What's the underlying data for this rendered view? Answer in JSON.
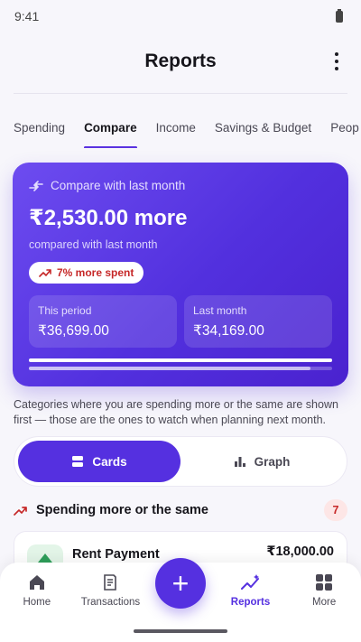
{
  "status": {
    "time": "9:41"
  },
  "header": {
    "title": "Reports"
  },
  "tabs": [
    "Spending",
    "Compare",
    "Income",
    "Savings & Budget",
    "Peop"
  ],
  "hero": {
    "heading": "Compare with last month",
    "amount": "₹2,530.00 more",
    "subtitle": "compared with last month",
    "pill": "7% more spent",
    "this_period_label": "This period",
    "this_period_value": "₹36,699.00",
    "last_month_label": "Last month",
    "last_month_value": "₹34,169.00",
    "this_period_fraction": 1.0,
    "last_month_fraction": 0.93
  },
  "note": "Categories where you are spending more or the same are shown first — those are the ones to watch when planning next month.",
  "view_toggle": {
    "cards_label": "Cards",
    "graph_label": "Graph",
    "selected": "Cards"
  },
  "section": {
    "title": "Spending more or the same",
    "count": "7"
  },
  "items": [
    {
      "name": "Rent Payment",
      "amount": "₹18,000.00"
    }
  ],
  "nav": {
    "home": "Home",
    "transactions": "Transactions",
    "reports": "Reports",
    "more": "More",
    "fab": "+"
  },
  "colors": {
    "accent": "#5530e0",
    "danger": "#c62828",
    "success": "#2e9e5a"
  }
}
